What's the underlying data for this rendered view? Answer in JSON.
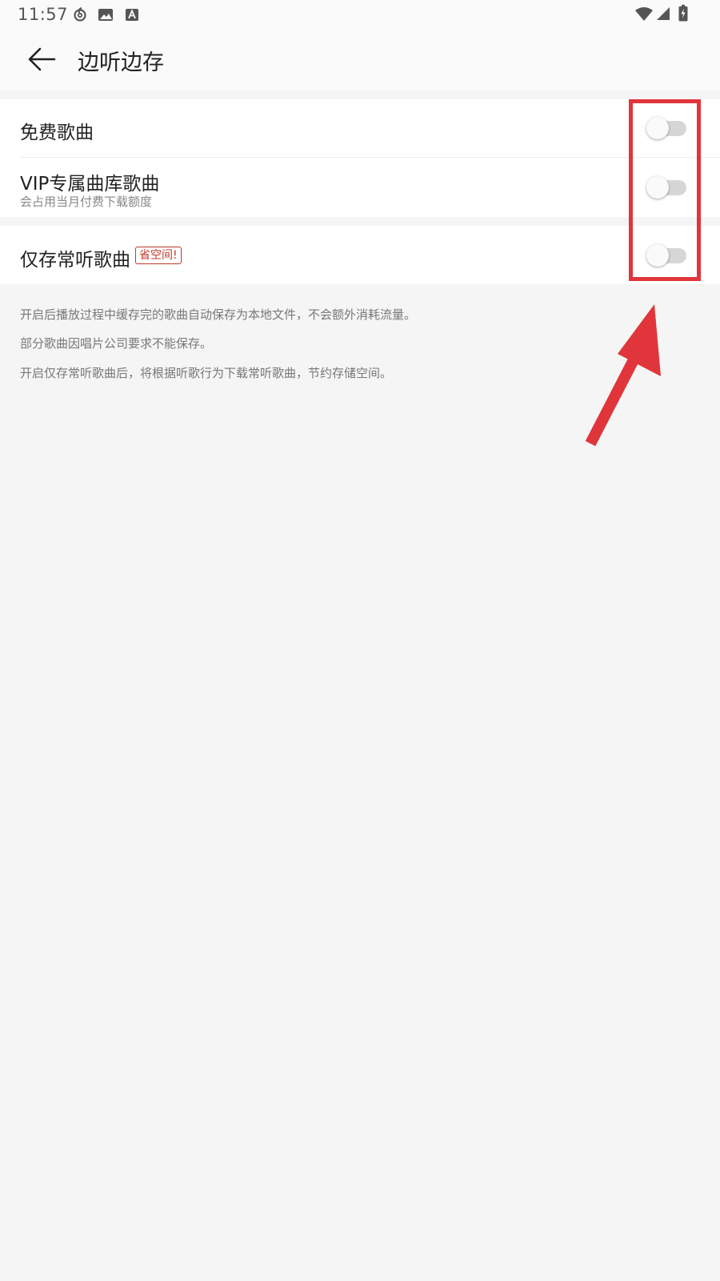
{
  "status_bar": {
    "time": "11:57",
    "left_icons": [
      "netease-music-icon",
      "image-icon",
      "text-icon"
    ],
    "right_icons": [
      "wifi-icon",
      "signal-icon",
      "battery-charging-icon"
    ]
  },
  "header": {
    "title": "边听边存",
    "back_icon": "back-arrow-icon"
  },
  "settings": {
    "free_songs": {
      "label": "免费歌曲",
      "enabled": false
    },
    "vip_songs": {
      "label": "VIP专属曲库歌曲",
      "sublabel": "会占用当月付费下载额度",
      "enabled": false
    },
    "frequent_songs": {
      "label": "仅存常听歌曲",
      "badge": "省空间!",
      "enabled": false
    }
  },
  "descriptions": [
    "开启后播放过程中缓存完的歌曲自动保存为本地文件，不会额外消耗流量。",
    "部分歌曲因唱片公司要求不能保存。",
    "开启仅存常听歌曲后，将根据听歌行为下载常听歌曲，节约存储空间。"
  ],
  "colors": {
    "annotation_red": "#e0353a",
    "badge_red": "#c0392b",
    "toggle_off_track": "#d6d6d6"
  }
}
